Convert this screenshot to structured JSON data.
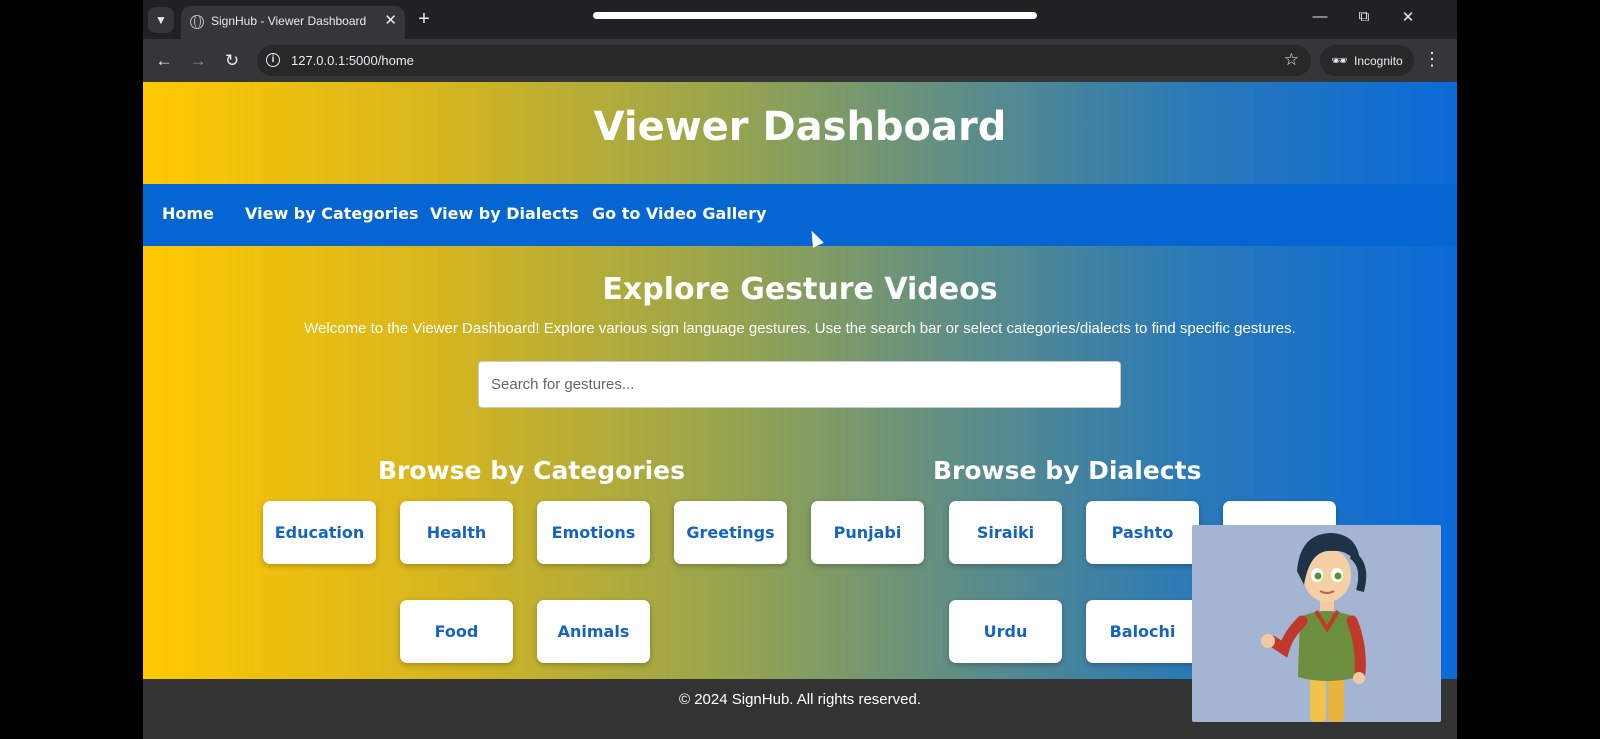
{
  "browser": {
    "tab_title": "SignHub - Viewer Dashboard",
    "url": "127.0.0.1:5000/home",
    "profile_label": "Incognito",
    "icons": {
      "tab_list": "chevron-down-icon",
      "favicon": "globe-icon",
      "tab_close": "close-icon",
      "new_tab": "plus-icon",
      "minimize": "minimize-icon",
      "restore": "restore-icon",
      "close_window": "close-icon",
      "back": "arrow-left-icon",
      "forward": "arrow-right-icon",
      "reload": "reload-icon",
      "site_info": "info-icon",
      "bookmark": "star-icon",
      "incognito": "incognito-icon",
      "menu": "kebab-icon"
    }
  },
  "page": {
    "title": "Viewer Dashboard",
    "nav": [
      {
        "label": "Home"
      },
      {
        "label": "View by Categories"
      },
      {
        "label": "View by Dialects"
      },
      {
        "label": "Go to Video Gallery"
      }
    ],
    "explore_title": "Explore Gesture Videos",
    "welcome_text": "Welcome to the Viewer Dashboard! Explore various sign language gestures. Use the search bar or select categories/dialects to find specific gestures.",
    "search": {
      "placeholder": "Search for gestures...",
      "value": ""
    },
    "categories": {
      "title": "Browse by Categories",
      "items": [
        "Education",
        "Health",
        "Emotions",
        "Greetings",
        "Punjabi",
        "Food",
        "Animals"
      ]
    },
    "dialects": {
      "title": "Browse by Dialects",
      "items": [
        "Siraiki",
        "Pashto",
        "Urdu",
        "Balochi"
      ]
    },
    "footer": "© 2024 SignHub. All rights reserved."
  },
  "colors": {
    "gradient_start": "#ffc802",
    "gradient_end": "#0a6ad8",
    "navbar": "#0565d3",
    "chip_text": "#1565c0",
    "footer_bg": "#333333",
    "avatar_bg": "#a3b5d3"
  }
}
